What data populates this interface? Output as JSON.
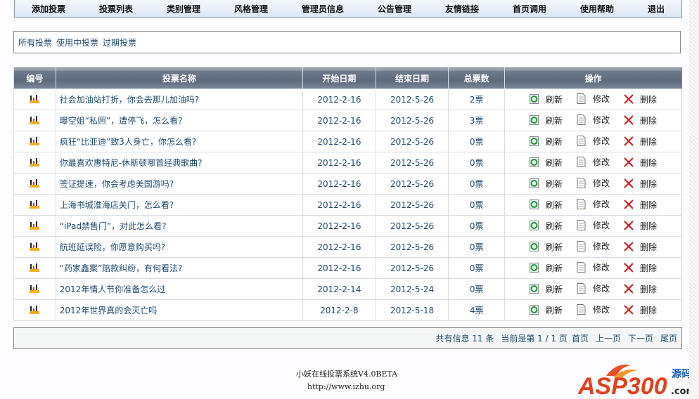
{
  "nav": [
    "添加投票",
    "投票列表",
    "类别管理",
    "风格管理",
    "管理员信息",
    "公告管理",
    "友情链接",
    "首页调用",
    "使用帮助",
    "退出"
  ],
  "filters": [
    "所有投票",
    "使用中投票",
    "过期投票"
  ],
  "table": {
    "headers": [
      "编号",
      "投票名称",
      "开始日期",
      "结束日期",
      "总票数",
      "操作"
    ],
    "actions": {
      "refresh": "刷新",
      "edit": "修改",
      "delete": "删除"
    },
    "rows": [
      {
        "name": "社会加油站打折，你会去那儿加油吗?",
        "start": "2012-2-16",
        "end": "2012-5-26",
        "votes": "2票"
      },
      {
        "name": "曝空姐“私照”，遭停飞，怎么看?",
        "start": "2012-2-16",
        "end": "2012-5-26",
        "votes": "3票"
      },
      {
        "name": "疯狂“比亚迪”致3人身亡，你怎么看?",
        "start": "2012-2-16",
        "end": "2012-5-26",
        "votes": "0票"
      },
      {
        "name": "你最喜欢惠特尼-休斯顿哪首经典歌曲?",
        "start": "2012-2-16",
        "end": "2012-5-26",
        "votes": "0票"
      },
      {
        "name": "签证提速，你会考虑美国游吗?",
        "start": "2012-2-16",
        "end": "2012-5-26",
        "votes": "0票"
      },
      {
        "name": "上海书城淮海店关门，怎么看?",
        "start": "2012-2-16",
        "end": "2012-5-26",
        "votes": "0票"
      },
      {
        "name": "“iPad禁售门”，对此怎么看?",
        "start": "2012-2-16",
        "end": "2012-5-26",
        "votes": "0票"
      },
      {
        "name": "航班延误险，你愿意购买吗?",
        "start": "2012-2-16",
        "end": "2012-5-26",
        "votes": "0票"
      },
      {
        "name": "“药家鑫案”赔款纠纷，有何看法?",
        "start": "2012-2-16",
        "end": "2012-5-26",
        "votes": "0票"
      },
      {
        "name": "2012年情人节你准备怎么过",
        "start": "2012-2-14",
        "end": "2012-5-24",
        "votes": "0票"
      },
      {
        "name": "2012年世界真的会灭亡吗",
        "start": "2012-2-8",
        "end": "2012-5-18",
        "votes": "4票"
      }
    ]
  },
  "pager": {
    "total": "共有信息 11 条",
    "current": "当前是第 1 / 1 页",
    "first": "首页",
    "prev": "上一页",
    "next": "下一页",
    "last": "尾页"
  },
  "footer": {
    "title": "小妖在线投票系统V4.0BETA",
    "url": "http://www.izhu.org"
  },
  "logo": {
    "text": "ASP300",
    "sub": "源码",
    "com": ".com"
  }
}
